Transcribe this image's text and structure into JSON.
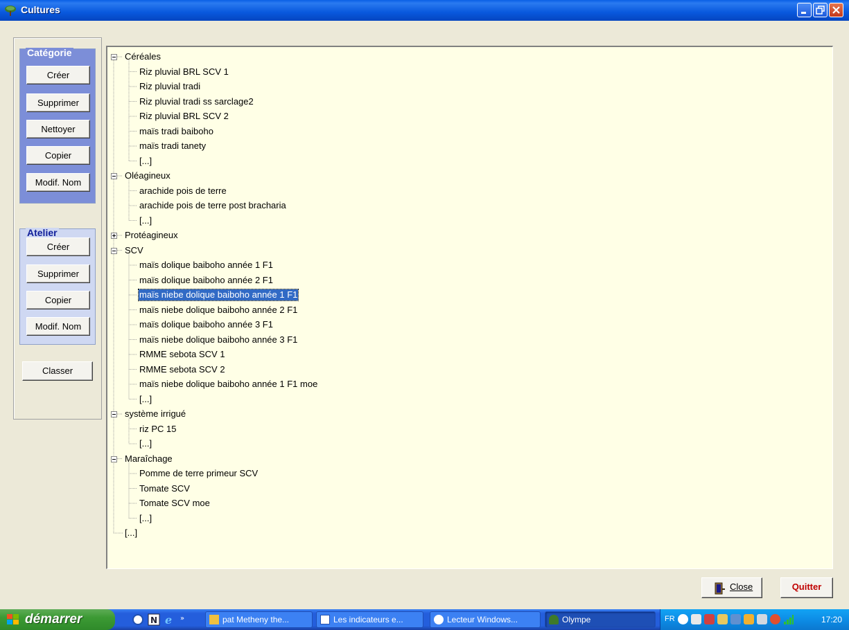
{
  "window": {
    "title": "Cultures"
  },
  "categorie": {
    "title": "Catégorie",
    "buttons": [
      "Créer",
      "Supprimer",
      "Nettoyer",
      "Copier",
      "Modif. Nom"
    ]
  },
  "atelier": {
    "title": "Atelier",
    "buttons": [
      "Créer",
      "Supprimer",
      "Copier",
      "Modif. Nom"
    ]
  },
  "classer_label": "Classer",
  "tree": [
    {
      "label": "Céréales",
      "expanded": true,
      "children": [
        "Riz pluvial BRL SCV 1",
        "Riz pluvial tradi",
        "Riz pluvial tradi ss sarclage2",
        "Riz pluvial BRL SCV 2",
        "maïs tradi baiboho",
        "maïs tradi tanety",
        "[...]"
      ]
    },
    {
      "label": "Oléagineux",
      "expanded": true,
      "children": [
        "arachide pois de terre",
        "arachide pois de terre post bracharia",
        "[...]"
      ]
    },
    {
      "label": "Protéagineux",
      "expanded": false,
      "children": []
    },
    {
      "label": "SCV",
      "expanded": true,
      "children": [
        "maïs dolique baiboho année 1 F1",
        "maïs dolique baiboho année 2 F1",
        "maïs niebe dolique baiboho année 1 F1",
        "maïs niebe dolique baiboho année 2 F1",
        "maïs dolique baiboho année 3 F1",
        "maïs niebe dolique baiboho année 3 F1",
        "RMME sebota SCV 1",
        "RMME sebota SCV 2",
        "maïs niebe dolique baiboho année 1 F1 moe",
        "[...]"
      ]
    },
    {
      "label": "système irrigué",
      "expanded": true,
      "children": [
        "riz PC 15",
        "[...]"
      ]
    },
    {
      "label": "Maraîchage",
      "expanded": true,
      "children": [
        "Pomme de terre primeur SCV",
        "Tomate SCV",
        "Tomate SCV moe",
        "[...]"
      ]
    },
    {
      "label": "[...]",
      "leaf": true
    }
  ],
  "selected": "maïs niebe dolique baiboho année 1 F1",
  "bottom": {
    "close_label": "Close",
    "quitter_label": "Quitter"
  },
  "taskbar": {
    "start_label": "démarrer",
    "tasks": [
      "pat Metheny the...",
      "Les indicateurs e...",
      "Lecteur Windows...",
      "Olympe"
    ],
    "active_task": "Olympe",
    "tray_lang": "FR",
    "clock": "17:20"
  },
  "colors": {
    "selection": "#316AC5",
    "tree_bg": "#FFFFE6",
    "categorie_bg": "#7C8ED8",
    "quitter": "#C00000"
  }
}
